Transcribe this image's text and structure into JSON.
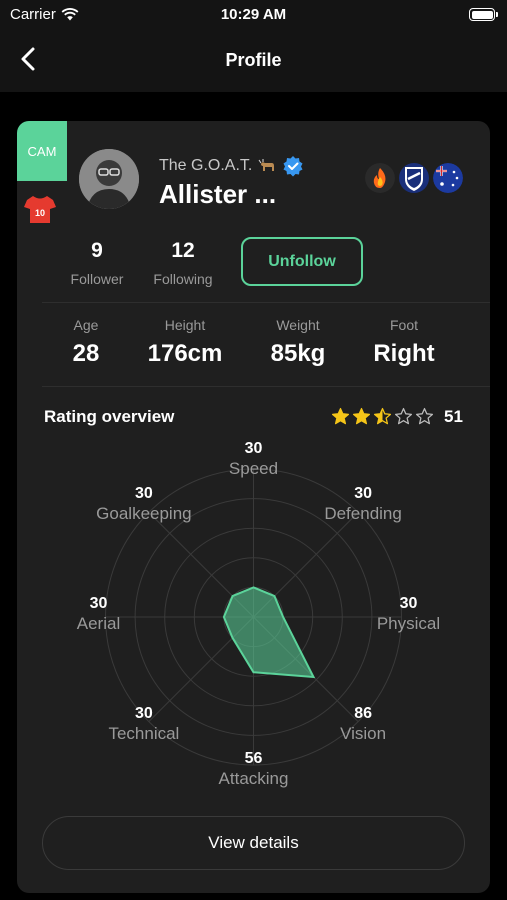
{
  "status_bar": {
    "carrier": "Carrier",
    "time": "10:29 AM"
  },
  "nav": {
    "title": "Profile",
    "back_icon": "chevron-left-icon"
  },
  "player": {
    "position": "CAM",
    "shirt_number": "10",
    "nickname": "The G.O.A.T.",
    "name": "Allister ...",
    "verified": true,
    "badges": [
      "fire-badge-icon",
      "club-crest-icon",
      "australia-flag-icon"
    ]
  },
  "social": {
    "follower_count": "9",
    "follower_label": "Follower",
    "following_count": "12",
    "following_label": "Following",
    "unfollow_label": "Unfollow"
  },
  "attributes": [
    {
      "label": "Age",
      "value": "28"
    },
    {
      "label": "Height",
      "value": "176cm"
    },
    {
      "label": "Weight",
      "value": "85kg"
    },
    {
      "label": "Foot",
      "value": "Right"
    }
  ],
  "rating": {
    "title": "Rating overview",
    "stars": 2.5,
    "max_stars": 5,
    "score": "51"
  },
  "chart_data": {
    "type": "radar",
    "axes": [
      "Speed",
      "Defending",
      "Physical",
      "Vision",
      "Attacking",
      "Technical",
      "Aerial",
      "Goalkeeping"
    ],
    "values": [
      30,
      30,
      30,
      86,
      56,
      30,
      30,
      30
    ],
    "max": 150,
    "rings": 5,
    "color": "#5bd39a"
  },
  "view_details_label": "View details",
  "colors": {
    "accent": "#5bd39a",
    "background": "#000000",
    "card": "#1f1f1f",
    "star": "#f5c518"
  }
}
